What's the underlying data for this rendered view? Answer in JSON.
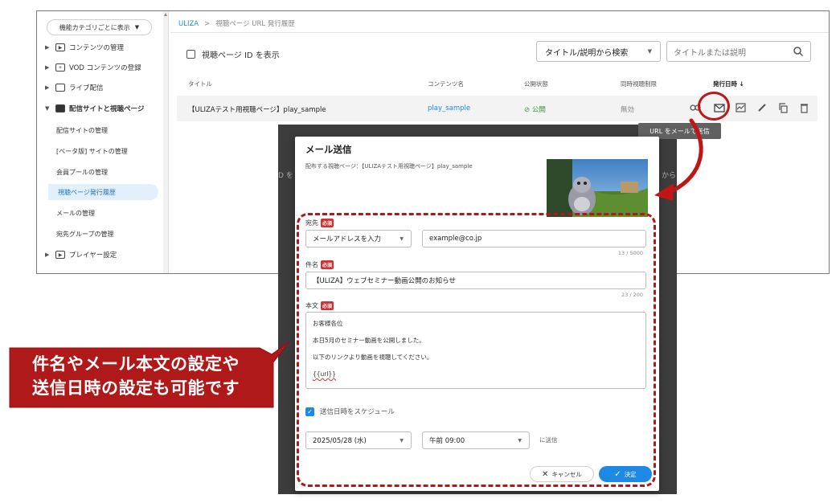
{
  "sidebar": {
    "category_select": "機能カテゴリごとに表示",
    "items": [
      {
        "label": "コンテンツの管理",
        "icon": "play-icon"
      },
      {
        "label": "VOD コンテンツの登録",
        "icon": "add-box-icon"
      },
      {
        "label": "ライブ配信",
        "icon": "live-camera-icon"
      },
      {
        "label": "配信サイトと視聴ページ",
        "icon": "site-icon",
        "expanded": true
      }
    ],
    "sub_items": [
      {
        "label": "配信サイトの管理"
      },
      {
        "label": "[ベータ版] サイトの管理"
      },
      {
        "label": "会員プールの管理"
      },
      {
        "label": "視聴ページ発行履歴",
        "active": true
      },
      {
        "label": "メールの管理"
      },
      {
        "label": "宛先グループの管理"
      }
    ],
    "player_settings": "プレイヤー設定"
  },
  "breadcrumb": {
    "root": "ULIZA",
    "separator": ">",
    "current": "視聴ページ URL 発行履歴"
  },
  "toolbar": {
    "show_id_label": "視聴ページ ID を表示",
    "search_type": "タイトル/説明から検索",
    "search_placeholder": "タイトルまたは説明"
  },
  "table": {
    "headers": [
      "タイトル",
      "コンテンツ名",
      "公開状態",
      "同時視聴制限",
      "発行日時 ↓"
    ],
    "rows": [
      {
        "title": "【ULIZAテスト用視聴ページ】play_sample",
        "content": "play_sample",
        "status": "公開",
        "limit": "無効"
      }
    ]
  },
  "tooltip": "URL をメールで送信",
  "modal": {
    "title": "メール送信",
    "subtitle": "配布する視聴ページ：【ULIZAテスト用視聴ページ】play_sample",
    "required_badge": "必須",
    "to": {
      "label": "宛先",
      "type": "メールアドレスを入力",
      "value": "example@co.jp",
      "counter": "13 / 5000"
    },
    "subject": {
      "label": "件名",
      "value": "【ULIZA】ウェブセミナー動画公開のお知らせ",
      "counter": "23 / 200"
    },
    "body": {
      "label": "本文",
      "lines": [
        "お客様各位",
        "本日5月のセミナー動画を公開しました。",
        "以下のリンクより動画を視聴してください。",
        "{{url}}"
      ]
    },
    "schedule": {
      "label": "送信日時をスケジュール",
      "checked": true,
      "date": "2025/05/28 (水)",
      "time": "午前 09:00",
      "suffix": "に送信"
    },
    "cancel_label": "キャンセル",
    "ok_label": "決定"
  },
  "callout": {
    "line1": "件名やメール本文の設定や",
    "line2": "送信日時の設定も可能です"
  },
  "colors": {
    "accent": "#1e88e5",
    "annotation": "#c21515",
    "required": "#d32f2f",
    "public_green": "#3a9a3a"
  }
}
